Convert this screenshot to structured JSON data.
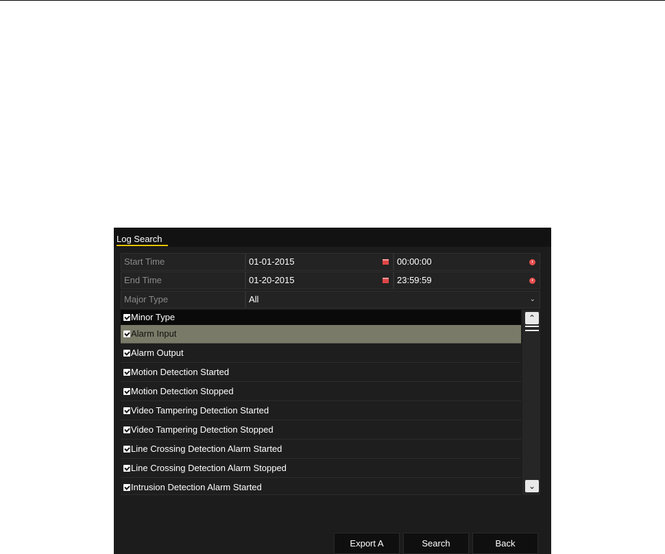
{
  "dialog": {
    "title": "Log Search"
  },
  "form": {
    "start_time": {
      "label": "Start Time",
      "date": "01-01-2015",
      "time": "00:00:00"
    },
    "end_time": {
      "label": "End Time",
      "date": "01-20-2015",
      "time": "23:59:59"
    },
    "major_type": {
      "label": "Major Type",
      "value": "All"
    }
  },
  "minor_list": {
    "header": "Minor Type",
    "items": [
      "Alarm Input",
      "Alarm Output",
      "Motion Detection Started",
      "Motion Detection Stopped",
      "Video Tampering Detection Started",
      "Video Tampering Detection Stopped",
      "Line Crossing Detection Alarm Started",
      "Line Crossing Detection Alarm Stopped",
      "Intrusion Detection Alarm Started"
    ],
    "selected": "Alarm Input"
  },
  "buttons": {
    "export": "Export A",
    "search": "Search",
    "back": "Back"
  },
  "icons": {
    "date": "calendar-icon",
    "time": "clock-icon",
    "dropdown": "chevron-down-icon"
  },
  "colors": {
    "title_accent": "#e8c400",
    "selected_row": "#7a7a68",
    "icon_red": "#e04646"
  }
}
